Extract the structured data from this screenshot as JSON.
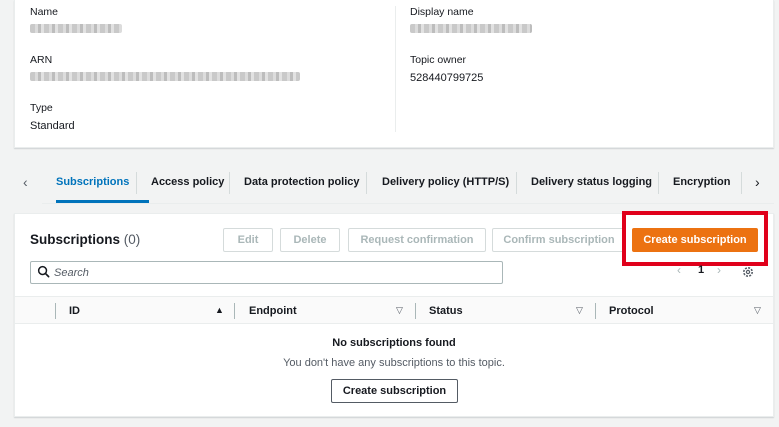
{
  "details": {
    "name_label": "Name",
    "display_name_label": "Display name",
    "arn_label": "ARN",
    "topic_owner_label": "Topic owner",
    "topic_owner_value": "528440799725",
    "type_label": "Type",
    "type_value": "Standard"
  },
  "tabs": [
    "Subscriptions",
    "Access policy",
    "Data protection policy",
    "Delivery policy (HTTP/S)",
    "Delivery status logging",
    "Encryption"
  ],
  "subscriptions": {
    "title": "Subscriptions",
    "count": "(0)",
    "buttons": {
      "edit": "Edit",
      "delete": "Delete",
      "request_confirmation": "Request confirmation",
      "confirm_subscription": "Confirm subscription",
      "create_subscription": "Create subscription"
    },
    "search_placeholder": "Search",
    "page": "1",
    "columns": [
      "ID",
      "Endpoint",
      "Status",
      "Protocol"
    ],
    "empty_title": "No subscriptions found",
    "empty_desc": "You don't have any subscriptions to this topic.",
    "empty_button": "Create subscription"
  },
  "colors": {
    "accent": "#0073bb",
    "primary": "#ec7211",
    "highlight": "#e0001b"
  }
}
